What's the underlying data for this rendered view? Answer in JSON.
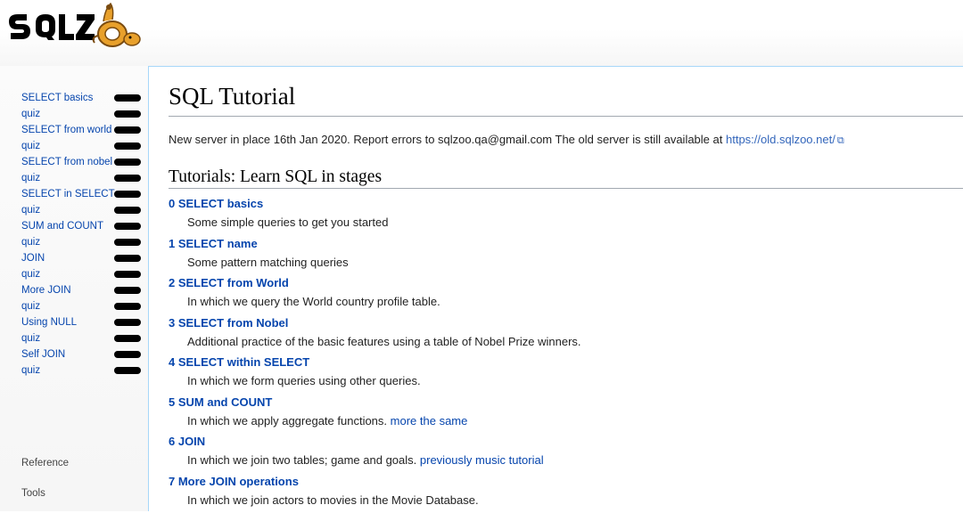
{
  "logo": {
    "text": "SQLZOO",
    "alt": "sqlzoo logo"
  },
  "sidebar": {
    "items": [
      "SELECT basics",
      "quiz",
      "SELECT from world",
      "quiz",
      "SELECT from nobel",
      "quiz",
      "SELECT in SELECT",
      "quiz",
      "SUM and COUNT",
      "quiz",
      "JOIN",
      "quiz",
      "More JOIN",
      "quiz",
      "Using NULL",
      "quiz",
      "Self JOIN",
      "quiz"
    ],
    "reference": "Reference",
    "tools": "Tools"
  },
  "main": {
    "title": "SQL Tutorial",
    "notice": "New server in place 16th Jan 2020. Report errors to sqlzoo.qa@gmail.com The old server is still available at",
    "notice_link": "https://old.sqlzoo.net/",
    "section": "Tutorials: Learn SQL in stages",
    "tutorials": [
      {
        "title": "0 SELECT basics",
        "desc": "Some simple queries to get you started",
        "extra": ""
      },
      {
        "title": "1 SELECT name",
        "desc": "Some pattern matching queries",
        "extra": ""
      },
      {
        "title": "2 SELECT from World",
        "desc": "In which we query the World country profile table.",
        "extra": ""
      },
      {
        "title": "3 SELECT from Nobel",
        "desc": "Additional practice of the basic features using a table of Nobel Prize winners.",
        "extra": ""
      },
      {
        "title": "4 SELECT within SELECT",
        "desc": "In which we form queries using other queries.",
        "extra": ""
      },
      {
        "title": "5 SUM and COUNT",
        "desc": "In which we apply aggregate functions.",
        "extra": "more the same"
      },
      {
        "title": "6 JOIN",
        "desc": "In which we join two tables; game and goals.",
        "extra": "previously music tutorial"
      },
      {
        "title": "7 More JOIN operations",
        "desc": "In which we join actors to movies in the Movie Database.",
        "extra": ""
      }
    ]
  }
}
